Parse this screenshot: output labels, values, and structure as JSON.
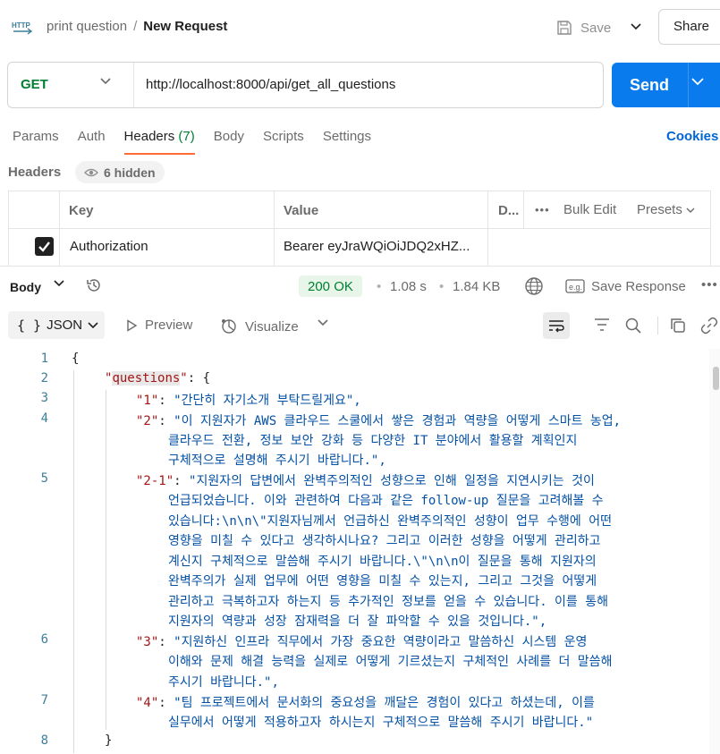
{
  "header": {
    "collection": "print question",
    "separator": "/",
    "request_name": "New Request",
    "save_label": "Save",
    "share_label": "Share"
  },
  "request": {
    "method": "GET",
    "url": "http://localhost:8000/api/get_all_questions",
    "send_label": "Send"
  },
  "tabs": [
    {
      "label": "Params"
    },
    {
      "label": "Auth"
    },
    {
      "label": "Headers",
      "count": "(7)",
      "active": true
    },
    {
      "label": "Body"
    },
    {
      "label": "Scripts"
    },
    {
      "label": "Settings"
    }
  ],
  "cookies_label": "Cookies",
  "headers_section": {
    "title": "Headers",
    "hidden_label": "6 hidden",
    "columns": {
      "key": "Key",
      "value": "Value",
      "description": "D...",
      "bulk_edit": "Bulk Edit",
      "presets": "Presets"
    },
    "rows": [
      {
        "checked": true,
        "key": "Authorization",
        "value": "Bearer eyJraWQiOiJDQ2xHZ..."
      }
    ]
  },
  "response": {
    "body_label": "Body",
    "status": "200 OK",
    "time": "1.08 s",
    "size": "1.84 KB",
    "save_response_label": "Save Response",
    "format": "JSON",
    "preview_label": "Preview",
    "visualize_label": "Visualize"
  },
  "code_lines": [
    {
      "n": "1",
      "text": "{"
    },
    {
      "n": "2",
      "key": "questions"
    },
    {
      "n": "3",
      "key": "1",
      "value": "간단히 자기소개 부탁드릴게요"
    },
    {
      "n": "4",
      "key": "2",
      "value": "이 지원자가 AWS 클라우드 스쿨에서 쌓은 경험과 역량을 어떻게 스마트 농업, 클라우드 전환, 정보 보안 강화 등 다양한 IT 분야에서 활용할 계획인지 구체적으로 설명해 주시기 바랍니다."
    },
    {
      "n": "5",
      "key": "2-1",
      "value": "지원자의 답변에서 완벽주의적인 성향으로 인해 일정을 지연시키는 것이 언급되었습니다. 이와 관련하여 다음과 같은 follow-up 질문을 고려해볼 수 있습니다:\\n\\n\\\"지원자님께서 언급하신 완벽주의적인 성향이 업무 수행에 어떤 영향을 미칠 수 있다고 생각하시나요? 그리고 이러한 성향을 어떻게 관리하고 계신지 구체적으로 말씀해 주시기 바랍니다.\\\"\\n\\n이 질문을 통해 지원자의 완벽주의가 실제 업무에 어떤 영향을 미칠 수 있는지, 그리고 그것을 어떻게 관리하고 극복하고자 하는지 등 추가적인 정보를 얻을 수 있습니다. 이를 통해 지원자의 역량과 성장 잠재력을 더 잘 파악할 수 있을 것입니다."
    },
    {
      "n": "6",
      "key": "3",
      "value": "지원하신 인프라 직무에서 가장 중요한 역량이라고 말씀하신 시스템 운영 이해와 문제 해결 능력을 실제로 어떻게 기르셨는지 구체적인 사례를 더 말씀해 주시기 바랍니다."
    },
    {
      "n": "7",
      "key": "4",
      "value": "팀 프로젝트에서 문서화의 중요성을 깨달은 경험이 있다고 하셨는데, 이를 실무에서 어떻게 적용하고자 하시는지 구체적으로 말씀해 주시기 바랍니다."
    },
    {
      "n": "8",
      "text": "}"
    }
  ],
  "wrapped_text": {
    "l3": "\"간단히 자기소개 부탁드릴게요\",",
    "l4a": "\"이 지원자가 AWS 클라우드 스쿨에서 쌓은 경험과 역량을 어떻게 스마트 농업,",
    "l4b": "클라우드 전환, 정보 보안 강화 등 다양한 IT 분야에서 활용할 계획인지",
    "l4c": "구체적으로 설명해 주시기 바랍니다.\",",
    "l5a": "\"지원자의 답변에서 완벽주의적인 성향으로 인해 일정을 지연시키는 것이",
    "l5b": "언급되었습니다. 이와 관련하여 다음과 같은 follow-up 질문을 고려해볼 수",
    "l5c": "있습니다:\\n\\n\\\"지원자님께서 언급하신 완벽주의적인 성향이 업무 수행에 어떤",
    "l5d": "영향을 미칠 수 있다고 생각하시나요? 그리고 이러한 성향을 어떻게 관리하고",
    "l5e": "계신지 구체적으로 말씀해 주시기 바랍니다.\\\"\\n\\n이 질문을 통해 지원자의",
    "l5f": "완벽주의가 실제 업무에 어떤 영향을 미칠 수 있는지, 그리고 그것을 어떻게",
    "l5g": "관리하고 극복하고자 하는지 등 추가적인 정보를 얻을 수 있습니다. 이를 통해",
    "l5h": "지원자의 역량과 성장 잠재력을 더 잘 파악할 수 있을 것입니다.\",",
    "l6a": "\"지원하신 인프라 직무에서 가장 중요한 역량이라고 말씀하신 시스템 운영",
    "l6b": "이해와 문제 해결 능력을 실제로 어떻게 기르셨는지 구체적인 사례를 더 말씀해",
    "l6c": "주시기 바랍니다.\",",
    "l7a": "\"팀 프로젝트에서 문서화의 중요성을 깨달은 경험이 있다고 하셨는데, 이를",
    "l7b": "실무에서 어떻게 적용하고자 하시는지 구체적으로 말씀해 주시기 바랍니다.\"",
    "k3": "\"1\"",
    "k4": "\"2\"",
    "k5": "\"2-1\"",
    "k6": "\"3\"",
    "k7": "\"4\"",
    "k2": "questions",
    "colon": ": ",
    "open": "{",
    "close": "}"
  },
  "colors": {
    "accent": "#ff6c37",
    "send": "#097bed",
    "method": "#007f31",
    "json_key": "#a31515",
    "json_string": "#0451a5"
  }
}
